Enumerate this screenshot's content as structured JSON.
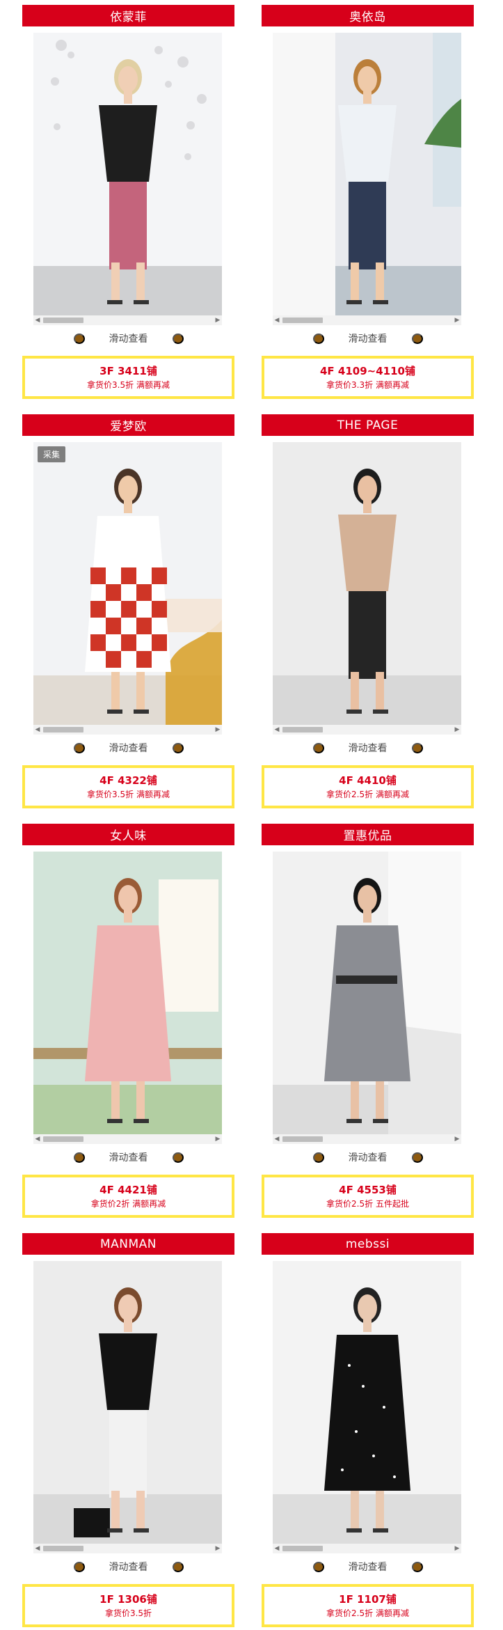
{
  "ui": {
    "swipe_hint": "滑动查看",
    "collect_badge": "采集"
  },
  "cards": [
    {
      "brand": "依蒙菲",
      "floor": "3F 3411铺",
      "discount": "拿货价3.5折 满额再减",
      "has_collect_badge": false,
      "photo": {
        "background": "#f4f5f7",
        "floor": "#cfd0d2",
        "accent": "#000000",
        "skin": "#f0cfb5",
        "hair": "#e1cfa2",
        "outfit": "#1e1e1e",
        "detail": "#c4647c",
        "scene_icon": "bubble-scene"
      }
    },
    {
      "brand": "奥依岛",
      "floor": "4F 4109~4110铺",
      "discount": "拿货价3.3折 满额再减",
      "has_collect_badge": false,
      "photo": {
        "background": "#e8eaee",
        "floor": "#bcc5cc",
        "accent": "#3f7a34",
        "skin": "#efcaa9",
        "hair": "#bb7f3a",
        "outfit": "#eef2f6",
        "detail": "#2f3b55",
        "scene_icon": "palm-scene"
      }
    },
    {
      "brand": "爱梦欧",
      "floor": "4F 4322铺",
      "discount": "拿货价3.5折 满额再减",
      "has_collect_badge": true,
      "photo": {
        "background": "#f2f3f5",
        "floor": "#e1dbd3",
        "accent": "#d8a02a",
        "skin": "#efcaa9",
        "hair": "#4a3427",
        "outfit": "#ffffff",
        "detail": "#cf3526",
        "scene_icon": "checker-scene"
      }
    },
    {
      "brand": "THE PAGE",
      "floor": "4F 4410铺",
      "discount": "拿货价2.5折 满额再减",
      "has_collect_badge": false,
      "photo": {
        "background": "#ececec",
        "floor": "#d8d8d8",
        "accent": "#9b9b9b",
        "skin": "#e9c0a2",
        "hair": "#1d1d1d",
        "outfit": "#d4b196",
        "detail": "#252525",
        "scene_icon": "blazer-scene"
      }
    },
    {
      "brand": "女人味",
      "floor": "4F 4421铺",
      "discount": "拿货价2折 满额再减",
      "has_collect_badge": false,
      "photo": {
        "background": "#dce9e1",
        "floor": "#9dbd73",
        "accent": "#fff9f2",
        "skin": "#efc6ad",
        "hair": "#9a5b36",
        "outfit": "#efb3b2",
        "detail": "#e58ca0",
        "scene_icon": "garden-scene"
      }
    },
    {
      "brand": "置惠优品",
      "floor": "4F 4553铺",
      "discount": "拿货价2.5折 五件起批",
      "has_collect_badge": false,
      "photo": {
        "background": "#f1f1f1",
        "floor": "#dcdcdc",
        "accent": "#f9f9f9",
        "skin": "#e8c1a5",
        "hair": "#151515",
        "outfit": "#8b8d93",
        "detail": "#2b2b2b",
        "scene_icon": "studio-scene"
      }
    },
    {
      "brand": "MANMAN",
      "floor": "1F 1306铺",
      "discount": "拿货价3.5折",
      "has_collect_badge": false,
      "photo": {
        "background": "#ececec",
        "floor": "#d9d9d9",
        "accent": "#c7a86a",
        "skin": "#efcbb4",
        "hair": "#7b4b2d",
        "outfit": "#121212",
        "detail": "#f3f3f3",
        "scene_icon": "camisole-scene"
      }
    },
    {
      "brand": "mebssi",
      "floor": "1F 1107铺",
      "discount": "拿货价2.5折 满额再减",
      "has_collect_badge": false,
      "photo": {
        "background": "#f3f3f3",
        "floor": "#dddddd",
        "accent": "#d1a052",
        "skin": "#e9c9b1",
        "hair": "#222222",
        "outfit": "#111111",
        "detail": "#ffffff",
        "scene_icon": "dotdress-scene"
      }
    }
  ]
}
